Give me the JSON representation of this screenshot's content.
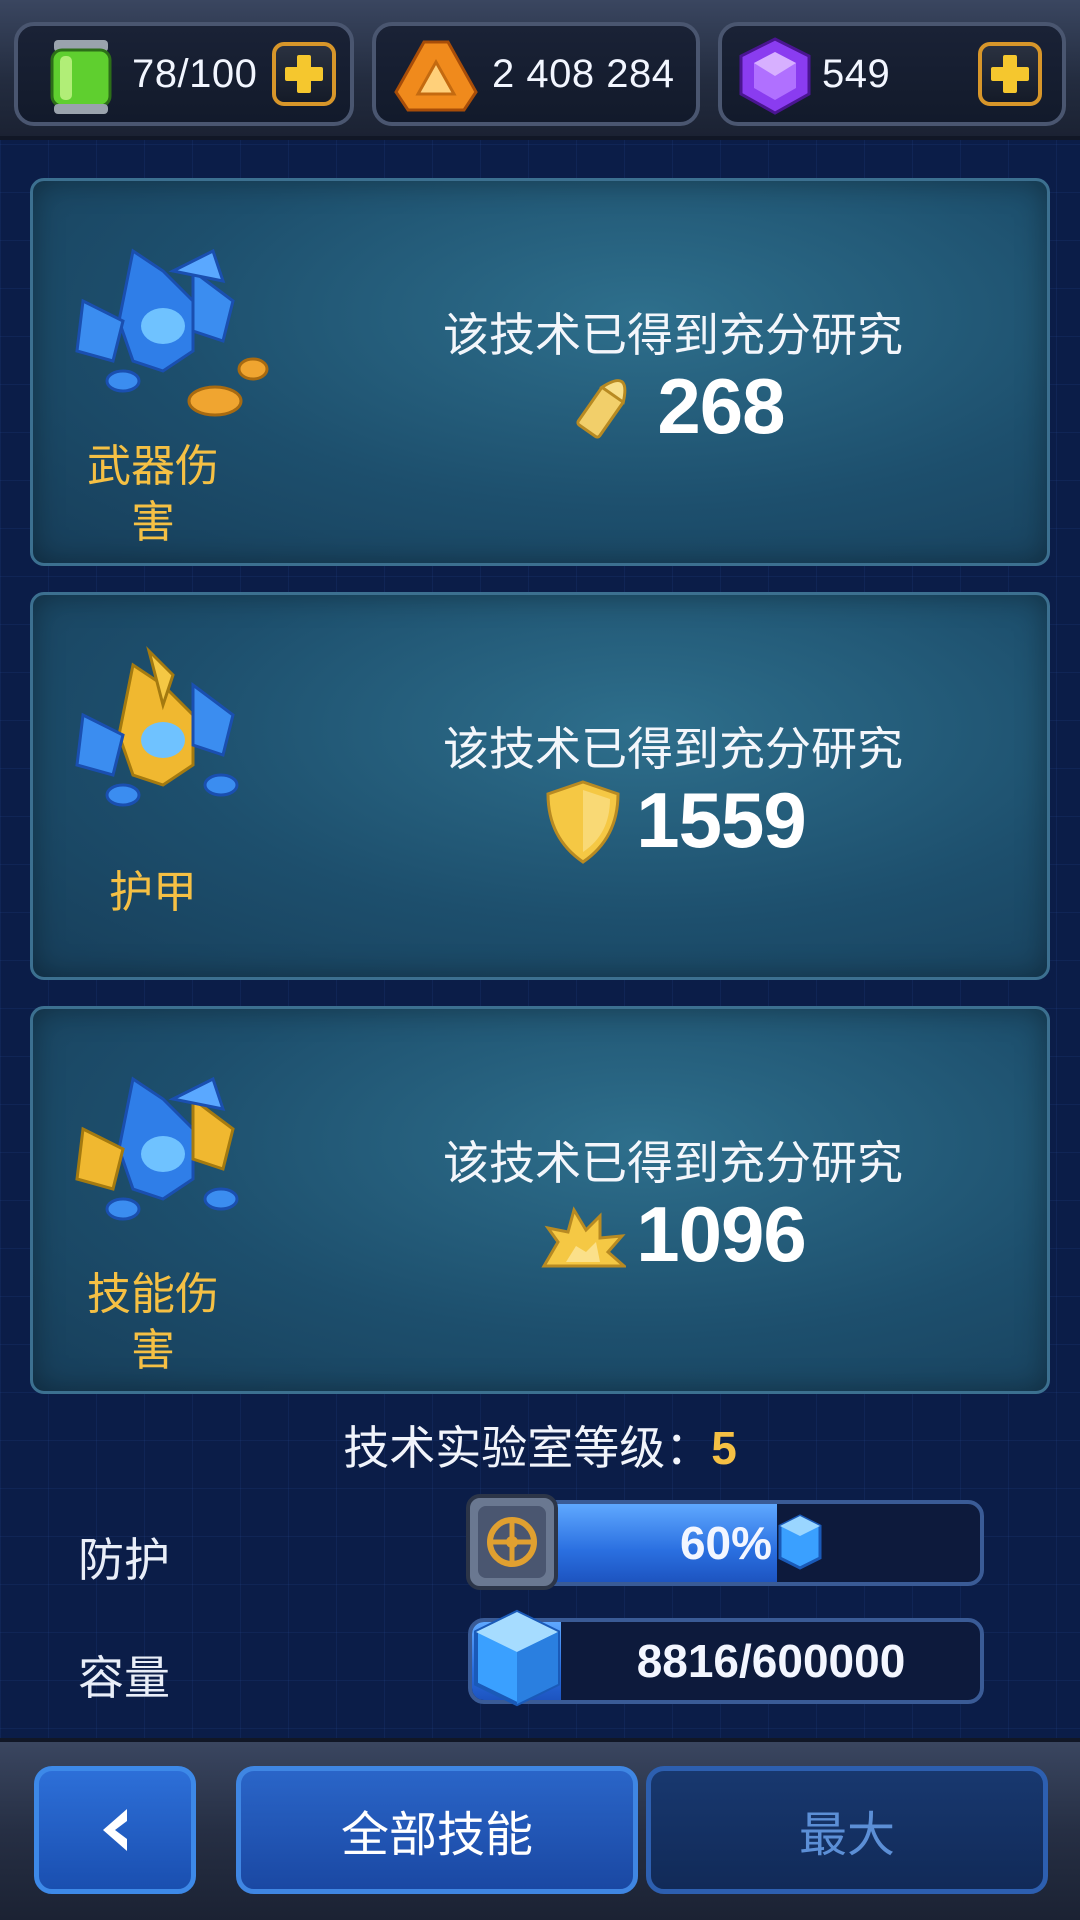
{
  "resources": {
    "energy": {
      "value": "78/100",
      "icon": "energy-canister-icon"
    },
    "credits": {
      "value": "2 408 284",
      "icon": "orange-triangle-crystal-icon"
    },
    "gems": {
      "value": "549",
      "icon": "purple-gem-icon"
    }
  },
  "cards": [
    {
      "name": "武器伤\n害",
      "message": "该技术已得到充分研究",
      "stat_icon": "bullet-icon",
      "value": "268"
    },
    {
      "name": "护甲",
      "message": "该技术已得到充分研究",
      "stat_icon": "shield-icon",
      "value": "1559"
    },
    {
      "name": "技能伤\n害",
      "message": "该技术已得到充分研究",
      "stat_icon": "explosion-icon",
      "value": "1096"
    }
  ],
  "lab": {
    "label": "技术实验室等级：",
    "level": "5"
  },
  "protection": {
    "label": "防护",
    "value": "60%",
    "fraction": 0.6
  },
  "capacity": {
    "label": "容量",
    "value": "8816/600000",
    "fraction": 0.015
  },
  "nav": {
    "all_skills": "全部技能",
    "max": "最大"
  },
  "colors": {
    "accent_gold": "#f5c044",
    "button_blue": "#2a65c8"
  }
}
